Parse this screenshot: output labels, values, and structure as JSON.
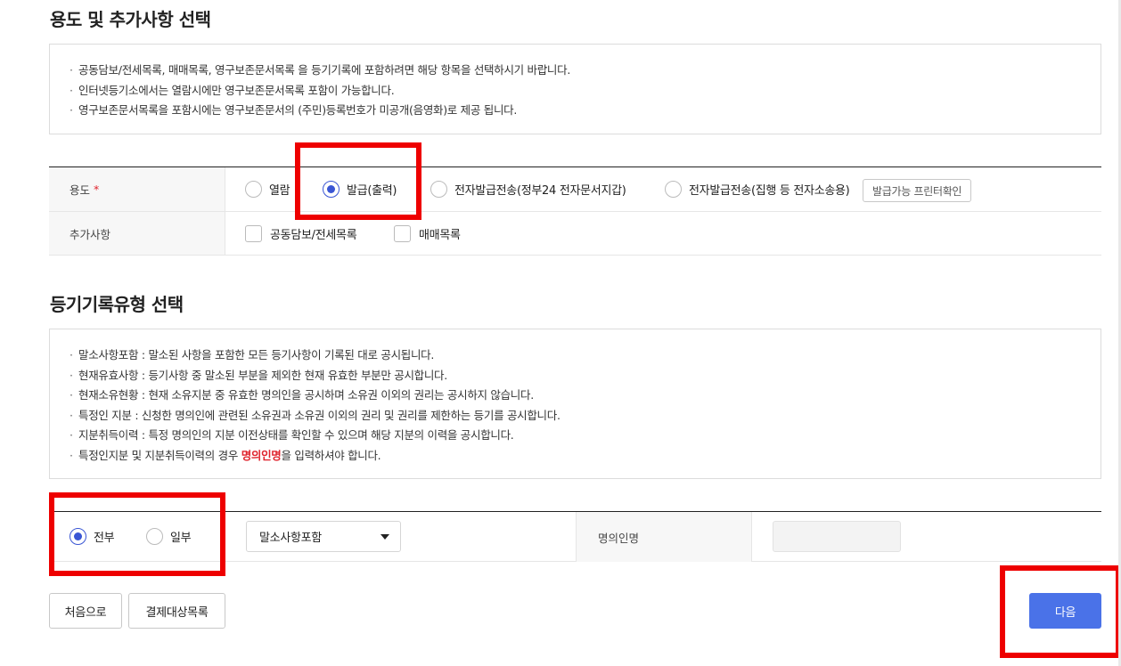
{
  "section1": {
    "title": "용도 및 추가사항 선택",
    "notices": [
      "공동담보/전세목록, 매매목록, 영구보존문서목록 을 등기기록에 포함하려면 해당 항목을 선택하시기 바랍니다.",
      "인터넷등기소에서는 열람시에만 영구보존문서목록 포함이 가능합니다.",
      "영구보존문서목록을 포함시에는 영구보존문서의 (주민)등록번호가 미공개(음영화)로 제공 됩니다."
    ],
    "purpose": {
      "label": "용도",
      "required_mark": "*",
      "options": [
        "열람",
        "발급(출력)",
        "전자발급전송(정부24 전자문서지갑)",
        "전자발급전송(집행 등 전자소송용)"
      ],
      "selected": "발급(출력)",
      "printer_check_button": "발급가능 프린터확인"
    },
    "extras": {
      "label": "추가사항",
      "options": [
        "공동담보/전세목록",
        "매매목록"
      ]
    }
  },
  "section2": {
    "title": "등기기록유형 선택",
    "notices": [
      "말소사항포함 : 말소된 사항을 포함한 모든 등기사항이 기록된 대로 공시됩니다.",
      "현재유효사항 : 등기사항 중 말소된 부분을 제외한 현재 유효한 부분만 공시합니다.",
      "현재소유현황 : 현재 소유지분 중 유효한 명의인을 공시하며 소유권 이외의 권리는 공시하지 않습니다.",
      "특정인 지분 : 신청한 명의인에 관련된 소유권과 소유권 이외의 권리 및 권리를 제한하는 등기를 공시합니다.",
      "지분취득이력 : 특정 명의인의 지분 이전상태를 확인할 수 있으며 해당 지분의 이력을 공시합니다."
    ],
    "last_notice": {
      "prefix": "특정인지분 및 지분취득이력의 경우 ",
      "emphasis": "명의인명",
      "suffix": "을 입력하셔야 합니다."
    },
    "scope": {
      "options": [
        "전부",
        "일부"
      ],
      "selected": "전부"
    },
    "record_type_select": {
      "selected": "말소사항포함"
    },
    "owner_name": {
      "label": "명의인명",
      "value": ""
    }
  },
  "buttons": {
    "first": "처음으로",
    "payment_list": "결제대상목록",
    "next": "다음"
  },
  "colors": {
    "accent": "#3a56d4",
    "primary_button": "#4a72e8",
    "required": "#e0242e",
    "highlight": "#ee0000"
  }
}
